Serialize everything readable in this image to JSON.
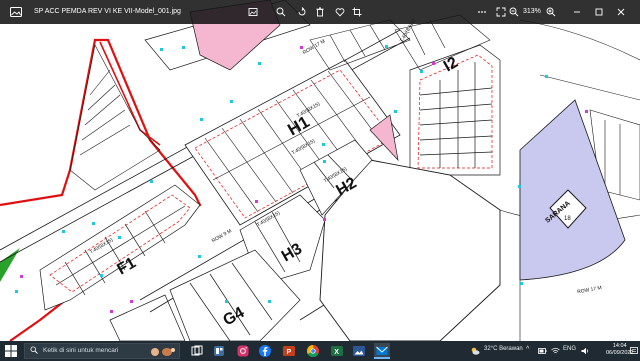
{
  "window": {
    "title": "SP ACC PEMDA REV VI KE VII-Model_001.jpg",
    "zoom": "313%"
  },
  "plan": {
    "labels": {
      "h1": "H1",
      "h2": "H2",
      "h3": "H3",
      "i2": "I2",
      "f1": "F1",
      "g4": "G4",
      "sarana": "SARANA",
      "sarana_num": "18",
      "row9": "ROW 9 M",
      "row17": "ROW 17 M",
      "row_top": "ROW 17 M",
      "h1_type": "T.40/(8X15)",
      "h1_type2": "T.40/(8X15)",
      "h2_type": "T.40/(8X15)",
      "h3_type": "T.40/(8X15)",
      "f1_type": "T.40/(8X15)",
      "i2_type": "T.40/(8X15)"
    },
    "colors": {
      "boundary": "#e01010",
      "dashed": "#e01010",
      "lines": "#1a1a1a",
      "marker": "#1ec8d8",
      "marker2": "#d23ad2",
      "pink": "#f5b6d0",
      "sarana": "#c9c9f0",
      "green": "#2aa12a"
    }
  },
  "search": {
    "placeholder": "Ketik di sini untuk mencari"
  },
  "taskbar": {
    "weather": "32°C Berawan",
    "lang": "ENG",
    "time": "14:04",
    "date": "06/09/2022"
  },
  "icons": {
    "title_left": "photo-app-icon",
    "toolbar": [
      "image-edit-icon",
      "zoom-icon",
      "rotate-icon",
      "delete-icon",
      "favorite-icon",
      "crop-icon",
      "more-icon",
      "expand-icon"
    ],
    "apps": [
      "task-view-icon",
      "widgets-icon",
      "instagram-icon",
      "facebook-icon",
      "powerpoint-icon",
      "chrome-icon",
      "excel-icon",
      "photos-icon",
      "mail-icon"
    ]
  }
}
